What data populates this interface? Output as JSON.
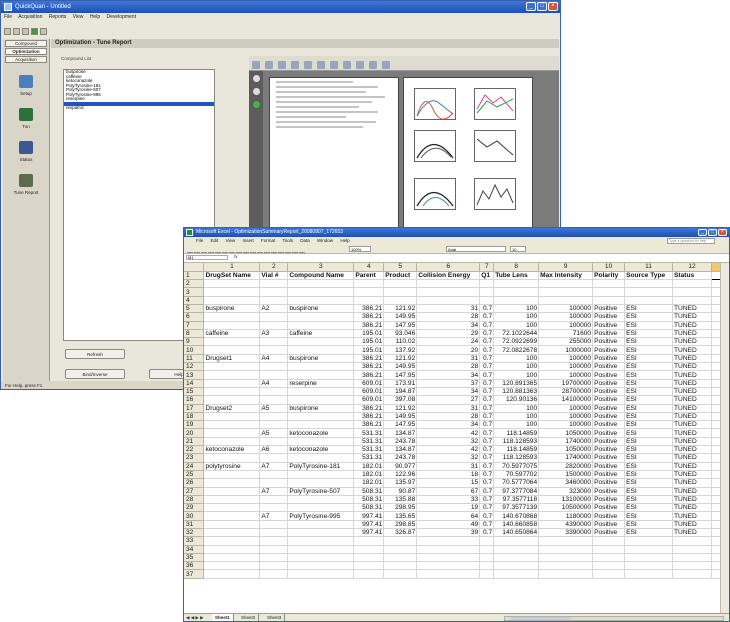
{
  "quickquan": {
    "title": "QuickQuan - Untitled",
    "menu": [
      "File",
      "Acquisition",
      "Reports",
      "View",
      "Help",
      "Development"
    ],
    "tabs": {
      "compound": "Compound",
      "optimization": "Optimization",
      "acquisition": "Acquisition"
    },
    "nav": [
      {
        "label": "Setup",
        "color": "#4a7fc2"
      },
      {
        "label": "Tun",
        "color": "#2f6f3b"
      },
      {
        "label": "Status",
        "color": "#3a5a8f"
      },
      {
        "label": "Tune Report",
        "color": "#5d6b4d"
      }
    ],
    "panel_title": "Optimization - Tune Report",
    "list_label": "Compound List",
    "compounds": [
      "buspirone",
      "caffeine",
      "ketoconazole",
      "PolyTyrosine-181",
      "PolyTyrosine-507",
      "PolyTyrosine-995",
      "reserpine",
      "",
      "rexpatrol"
    ],
    "selected_index": 7,
    "buttons": {
      "refresh": "Refresh",
      "bindinverse": "Bind/Inverse",
      "help": "Help"
    },
    "status_text": "For Help, press F1"
  },
  "excel": {
    "title": "Microsoft Excel - OptimizationSummaryReport_20080807_172653",
    "menu": [
      "File",
      "Edit",
      "View",
      "Insert",
      "Format",
      "Tools",
      "Data",
      "Window",
      "Help"
    ],
    "help_placeholder": "Type a question for help",
    "zoom": "100%",
    "font": "Arial",
    "font_size": "10",
    "name_box": "M1",
    "fx_label": "fx",
    "column_numbers": [
      "1",
      "2",
      "3",
      "4",
      "5",
      "6",
      "7",
      "8",
      "9",
      "10",
      "11",
      "12"
    ],
    "headers": [
      "DrugSet Name",
      "Vial #",
      "Compound Name",
      "Parent",
      "Product",
      "Collision Energy",
      "Q1",
      "Tube Lens",
      "Max Intensity",
      "Polarity",
      "Source Type",
      "Status"
    ],
    "rows": [
      [],
      [],
      [],
      [
        "buspirone",
        "A2",
        "buspirone",
        "386.21",
        "121.92",
        "31",
        "0.7",
        "100",
        "100000",
        "Positive",
        "ESI",
        "TUNED"
      ],
      [
        "",
        "",
        "",
        "386.21",
        "149.95",
        "28",
        "0.7",
        "100",
        "100000",
        "Positive",
        "ESI",
        "TUNED"
      ],
      [
        "",
        "",
        "",
        "386.21",
        "147.95",
        "34",
        "0.7",
        "100",
        "100000",
        "Positive",
        "ESI",
        "TUNED"
      ],
      [
        "caffeine",
        "A3",
        "caffeine",
        "195.01",
        "93.046",
        "29",
        "0.7",
        "72.1022644",
        "71600",
        "Positive",
        "ESI",
        "TUNED"
      ],
      [
        "",
        "",
        "",
        "195.01",
        "110.02",
        "24",
        "0.7",
        "72.0922699",
        "255000",
        "Positive",
        "ESI",
        "TUNED"
      ],
      [
        "",
        "",
        "",
        "195.01",
        "137.92",
        "20",
        "0.7",
        "72.0822678",
        "1000000",
        "Positive",
        "ESI",
        "TUNED"
      ],
      [
        "Drugset1",
        "A4",
        "buspirone",
        "386.21",
        "121.92",
        "31",
        "0.7",
        "100",
        "100000",
        "Positive",
        "ESI",
        "TUNED"
      ],
      [
        "",
        "",
        "",
        "386.21",
        "149.95",
        "28",
        "0.7",
        "100",
        "100000",
        "Positive",
        "ESI",
        "TUNED"
      ],
      [
        "",
        "",
        "",
        "386.21",
        "147.95",
        "34",
        "0.7",
        "100",
        "100000",
        "Positive",
        "ESI",
        "TUNED"
      ],
      [
        "",
        "A4",
        "reserpine",
        "609.01",
        "173.91",
        "37",
        "0.7",
        "120.891365",
        "19700000",
        "Positive",
        "ESI",
        "TUNED"
      ],
      [
        "",
        "",
        "",
        "609.01",
        "194.87",
        "34",
        "0.7",
        "120.881363",
        "28700000",
        "Positive",
        "ESI",
        "TUNED"
      ],
      [
        "",
        "",
        "",
        "609.01",
        "397.08",
        "27",
        "0.7",
        "120.90136",
        "14100000",
        "Positive",
        "ESI",
        "TUNED"
      ],
      [
        "Drugset2",
        "A5",
        "buspirone",
        "386.21",
        "121.92",
        "31",
        "0.7",
        "100",
        "100000",
        "Positive",
        "ESI",
        "TUNED"
      ],
      [
        "",
        "",
        "",
        "386.21",
        "149.95",
        "28",
        "0.7",
        "100",
        "100000",
        "Positive",
        "ESI",
        "TUNED"
      ],
      [
        "",
        "",
        "",
        "386.21",
        "147.95",
        "34",
        "0.7",
        "100",
        "100000",
        "Positive",
        "ESI",
        "TUNED"
      ],
      [
        "",
        "A5",
        "ketoconazole",
        "531.31",
        "134.87",
        "42",
        "0.7",
        "118.14859",
        "1050000",
        "Positive",
        "ESI",
        "TUNED"
      ],
      [
        "",
        "",
        "",
        "531.31",
        "243.78",
        "32",
        "0.7",
        "118.128593",
        "1740000",
        "Positive",
        "ESI",
        "TUNED"
      ],
      [
        "ketoconazole",
        "A6",
        "ketoconazole",
        "531.31",
        "134.87",
        "42",
        "0.7",
        "118.14859",
        "1050000",
        "Positive",
        "ESI",
        "TUNED"
      ],
      [
        "",
        "",
        "",
        "531.31",
        "243.78",
        "32",
        "0.7",
        "118.128593",
        "1740000",
        "Positive",
        "ESI",
        "TUNED"
      ],
      [
        "polytyrosine",
        "A7",
        "PolyTyrosine-181",
        "182.01",
        "90.977",
        "31",
        "0.7",
        "70.5977075",
        "2820000",
        "Positive",
        "ESI",
        "TUNED"
      ],
      [
        "",
        "",
        "",
        "182.01",
        "122.96",
        "18",
        "0.7",
        "70.597702",
        "1500000",
        "Positive",
        "ESI",
        "TUNED"
      ],
      [
        "",
        "",
        "",
        "182.01",
        "135.97",
        "15",
        "0.7",
        "70.5777064",
        "3460000",
        "Positive",
        "ESI",
        "TUNED"
      ],
      [
        "",
        "A7",
        "PolyTyrosine-507",
        "508.31",
        "90.87",
        "67",
        "0.7",
        "97.3777084",
        "323000",
        "Positive",
        "ESI",
        "TUNED"
      ],
      [
        "",
        "",
        "",
        "508.31",
        "135.88",
        "33",
        "0.7",
        "97.3577118",
        "13100000",
        "Positive",
        "ESI",
        "TUNED"
      ],
      [
        "",
        "",
        "",
        "508.31",
        "298.95",
        "19",
        "0.7",
        "97.3577139",
        "10500000",
        "Positive",
        "ESI",
        "TUNED"
      ],
      [
        "",
        "A7",
        "PolyTyrosine-995",
        "997.41",
        "135.65",
        "64",
        "0.7",
        "140.670868",
        "1180000",
        "Positive",
        "ESI",
        "TUNED"
      ],
      [
        "",
        "",
        "",
        "997.41",
        "298.85",
        "49",
        "0.7",
        "140.660858",
        "4390000",
        "Positive",
        "ESI",
        "TUNED"
      ],
      [
        "",
        "",
        "",
        "997.41",
        "326.87",
        "39",
        "0.7",
        "140.650864",
        "3390000",
        "Positive",
        "ESI",
        "TUNED"
      ],
      [],
      [],
      [],
      [],
      []
    ],
    "sheet_tabs": [
      "Sheet1",
      "Sheet2",
      "Sheet3"
    ],
    "tab_nav": "◀ ◀ ▶ ▶"
  }
}
